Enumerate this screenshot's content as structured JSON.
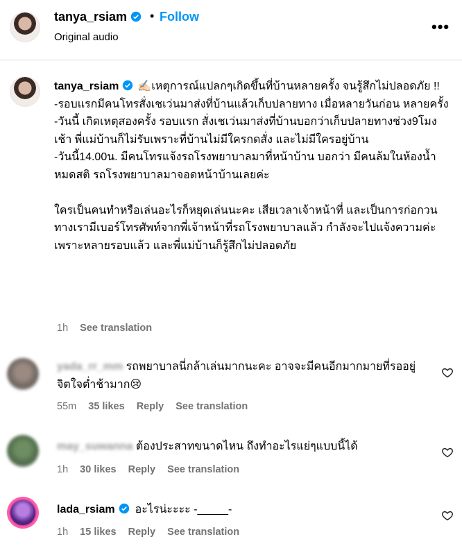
{
  "header": {
    "username": "tanya_rsiam",
    "follow_label": "Follow",
    "audio_label": "Original audio",
    "more_label": "•••"
  },
  "caption": {
    "username": "tanya_rsiam",
    "text": "✍🏻เหตุการณ์แปลกๆเกิดขึ้นที่บ้านหลายครั้ง จนรู้สึกไม่ปลอดภัย !!\n-รอบแรกมีคนโทรสั่งเชเว่นมาส่งที่บ้านแล้วเก็บปลายทาง เมื่อหลายวันก่อน หลายครั้ง\n-วันนี้ เกิดเหตุสองครั้ง รอบแรก สั่งเชเว่นมาส่งที่บ้านบอกว่าเก็บปลายทางช่วง9โมงเช้า พี่แม่บ้านก็ไม่รับเพราะที่บ้านไม่มีใครกดสั่ง และไม่มีใครอยู่บ้าน\n-วันนี้14.00น. มีคนโทรแจ้งรถโรงพยาบาลมาที่หน้าบ้าน บอกว่า มีคนล้มในห้องน้ำหมดสติ รถโรงพยาบาลมาจอดหน้าบ้านเลยค่ะ\n\nใครเป็นคนทำหรือเล่นอะไรก็หยุดเล่นนะคะ เสียเวลาเจ้าหน้าที่ และเป็นการก่อกวน ทางเรามีเบอร์โทรศัพท์จากพี่เจ้าหน้าที่รถโรงพยาบาลแล้ว กำลังจะไปแจ้งความค่ะ เพราะหลายรอบแล้ว และพี่แม่บ้านก็รู้สึกไม่ปลอดภัย",
    "time": "1h",
    "see_translation": "See translation"
  },
  "comments": [
    {
      "username": "yada_rr_mm",
      "text": "รถพยาบาลนี่กล้าเล่นมากนะคะ อาจจะมีคนอีกมากมายที่รออยู่ จิตใจต่ำช้ามาก😢",
      "time": "55m",
      "likes": "35 likes",
      "reply": "Reply",
      "see_translation": "See translation"
    },
    {
      "username": "may_suwanna",
      "text": "ต้องประสาทขนาดไหน ถึงทำอะไรแย่ๆแบบนี้ได้",
      "time": "1h",
      "likes": "30 likes",
      "reply": "Reply",
      "see_translation": "See translation"
    },
    {
      "username": "lada_rsiam",
      "text": "อะไรน่ะะะะ -_____-",
      "time": "1h",
      "likes": "15 likes",
      "reply": "Reply",
      "see_translation": "See translation"
    }
  ],
  "colors": {
    "link": "#0095f6",
    "verified": "#0095f6",
    "muted": "#737373"
  }
}
